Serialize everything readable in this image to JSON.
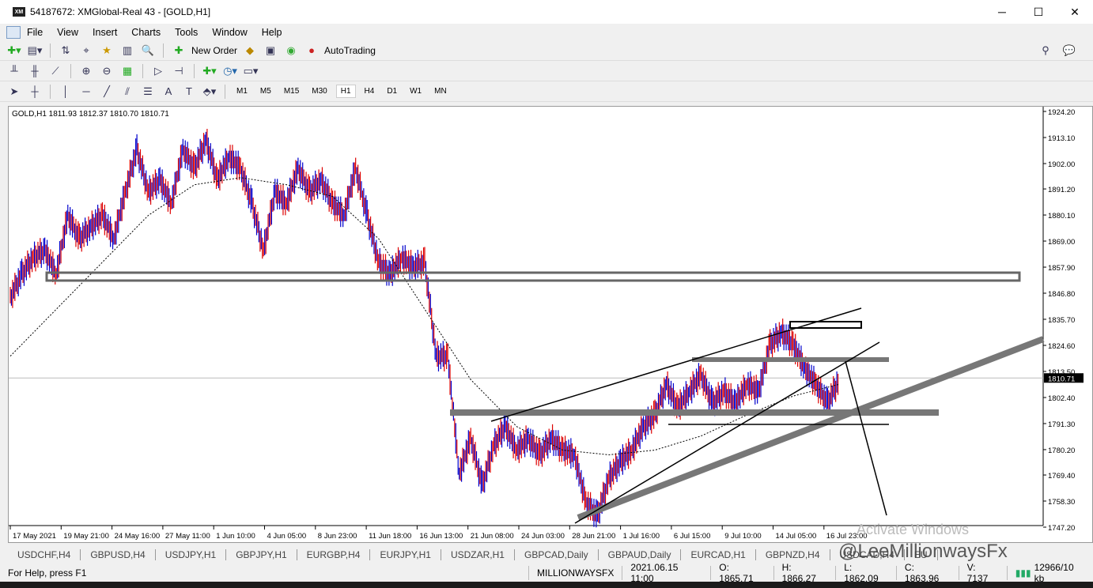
{
  "window": {
    "title": "54187672: XMGlobal-Real 43 - [GOLD,H1]",
    "logo": "XM"
  },
  "menu": [
    "File",
    "View",
    "Insert",
    "Charts",
    "Tools",
    "Window",
    "Help"
  ],
  "toolbar": {
    "new_order": "New Order",
    "autotrading": "AutoTrading"
  },
  "timeframes": [
    "M1",
    "M5",
    "M15",
    "M30",
    "H1",
    "H4",
    "D1",
    "W1",
    "MN"
  ],
  "active_timeframe": "H1",
  "chart_header": "GOLD,H1  1811.93 1812.37 1810.70 1810.71",
  "chart_data": {
    "type": "candlestick",
    "symbol": "GOLD",
    "timeframe": "H1",
    "ylim": [
      1747.2,
      1924.2
    ],
    "y_ticks": [
      "1924.20",
      "1913.10",
      "1902.00",
      "1891.20",
      "1880.10",
      "1869.00",
      "1857.90",
      "1846.80",
      "1835.70",
      "1824.60",
      "1813.50",
      "1802.40",
      "1791.30",
      "1780.20",
      "1769.40",
      "1758.30",
      "1747.20"
    ],
    "current_price": "1810.71",
    "x_ticks": [
      "17 May 2021",
      "19 May 21:00",
      "24 May 16:00",
      "27 May 11:00",
      "1 Jun 10:00",
      "4 Jun 05:00",
      "8 Jun 23:00",
      "11 Jun 18:00",
      "16 Jun 13:00",
      "21 Jun 08:00",
      "24 Jun 03:00",
      "28 Jun 21:00",
      "1 Jul 16:00",
      "6 Jul 15:00",
      "9 Jul 10:00",
      "14 Jul 05:00",
      "16 Jul 23:00"
    ],
    "closes": [
      1845,
      1855,
      1862,
      1865,
      1855,
      1880,
      1870,
      1875,
      1880,
      1870,
      1890,
      1908,
      1890,
      1895,
      1885,
      1908,
      1900,
      1912,
      1895,
      1905,
      1900,
      1885,
      1865,
      1890,
      1885,
      1900,
      1890,
      1895,
      1885,
      1880,
      1900,
      1880,
      1860,
      1855,
      1862,
      1858,
      1860,
      1820,
      1820,
      1770,
      1785,
      1765,
      1782,
      1790,
      1780,
      1785,
      1778,
      1785,
      1780,
      1778,
      1758,
      1752,
      1768,
      1775,
      1780,
      1790,
      1795,
      1808,
      1798,
      1805,
      1812,
      1800,
      1805,
      1800,
      1808,
      1805,
      1825,
      1830,
      1825,
      1815,
      1808,
      1800,
      1810
    ],
    "moving_average": [
      1820,
      1840,
      1860,
      1880,
      1893,
      1896,
      1893,
      1888,
      1870,
      1840,
      1810,
      1790,
      1780,
      1778,
      1780,
      1786,
      1795,
      1803,
      1808
    ]
  },
  "symbol_tabs": [
    "USDCHF,H4",
    "GBPUSD,H4",
    "USDJPY,H1",
    "GBPJPY,H1",
    "EURGBP,H4",
    "EURJPY,H1",
    "USDZAR,H1",
    "GBPCAD,Daily",
    "GBPAUD,Daily",
    "EURCAD,H1",
    "GBPNZD,H4",
    "USDCAD,H4",
    "EU"
  ],
  "status": {
    "help": "For Help, press F1",
    "profile": "MILLIONWAYSFX",
    "time": "2021.06.15 11:00",
    "open": "O: 1865.71",
    "high": "H: 1866.27",
    "low": "L: 1862.09",
    "close": "C: 1863.96",
    "volume": "V: 7137",
    "traffic": "12966/10 kb"
  },
  "watermark": {
    "activate": "Activate Windows",
    "handle": "@LeeMillionwaysFx"
  }
}
